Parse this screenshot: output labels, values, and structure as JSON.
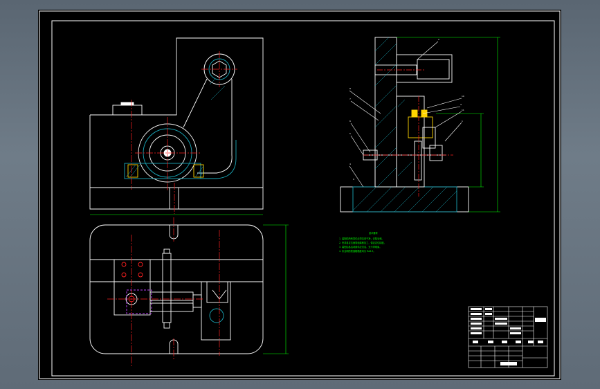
{
  "colors": {
    "background": "#000000",
    "outline": "#ffffff",
    "center_line": "#ff2020",
    "hatch": "#1aa7b8",
    "dimension": "#00ff00",
    "leader": "#ffffff",
    "hidden": "#c040ff"
  },
  "section_view": {
    "balloons": [
      "2",
      "8",
      "7",
      "6",
      "5",
      "4",
      "3",
      "10",
      "11",
      "1",
      "9"
    ]
  },
  "notes": {
    "heading": "技术要求",
    "lines": [
      "1. 装配前所有零件必须清洗干净，去除毛刺。",
      "2. 夹具各定位面需经磨削加工，保证定位精度。",
      "3. 装配后各活动部件应灵活，无卡滞现象。",
      "4. 未注明的表面粗糙度均为 Ra6.3。"
    ]
  },
  "title_block": {
    "rows": [
      "",
      "",
      "",
      "",
      "",
      ""
    ],
    "signature_labels": [
      "",
      "",
      "",
      "",
      ""
    ]
  }
}
